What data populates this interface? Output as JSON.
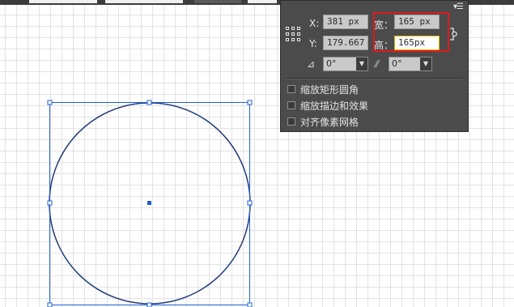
{
  "transform_panel": {
    "x_label": "X:",
    "x_value": "381 px",
    "y_label": "Y:",
    "y_value": "179.667 p",
    "width_label": "宽：",
    "width_value": "165 px",
    "height_label": "高：",
    "height_value": "165px",
    "rotate_value": "0°",
    "shear_value": "0°",
    "options": [
      {
        "label": "缩放矩形圆角",
        "checked": false
      },
      {
        "label": "缩放描边和效果",
        "checked": false
      },
      {
        "label": "对齐像素网格",
        "checked": false
      }
    ]
  },
  "icons": {
    "reference_point": "reference-point-grid-icon",
    "constrain": "link-proportions-icon",
    "rotate": "rotate-angle-icon",
    "shear": "shear-angle-icon",
    "menu": "panel-menu-icon"
  },
  "colors": {
    "panel_bg": "#4b4b4b",
    "selection": "#1f5fd1",
    "circle_stroke": "#1e3a7a",
    "highlight_box": "#e0191c",
    "active_field_border": "#e0b800"
  }
}
